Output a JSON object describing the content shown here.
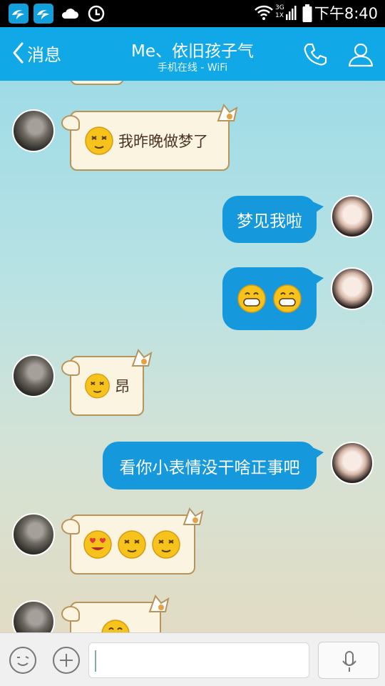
{
  "status_bar": {
    "time": "下午8:40",
    "net_3g": "3G",
    "net_1x": "1X"
  },
  "header": {
    "back_label": "消息",
    "title": "Me、依旧孩子气",
    "subtitle": "手机在线 - WiFi"
  },
  "messages": [
    {
      "side": "left",
      "text": "我昨晚做梦了",
      "emoji": [
        "sleepy-face-icon"
      ]
    },
    {
      "side": "right",
      "text": "梦见我啦",
      "emoji": []
    },
    {
      "side": "right",
      "text": "",
      "emoji": [
        "grin-face-icon",
        "grin-face-icon"
      ]
    },
    {
      "side": "left",
      "text": "昂",
      "emoji": [
        "sleepy-face-icon"
      ]
    },
    {
      "side": "right",
      "text": "看你小表情没干啥正事吧",
      "emoji": []
    },
    {
      "side": "left",
      "text": "",
      "emoji": [
        "heart-eyes-face-icon",
        "sleepy-face-icon",
        "sleepy-face-icon"
      ]
    },
    {
      "side": "left",
      "text": "",
      "emoji": [
        "grin-face-icon"
      ]
    }
  ],
  "input_bar": {
    "placeholder": ""
  },
  "colors": {
    "header_bg": "#10a8e6",
    "sent_bubble": "#1599dc",
    "received_bubble": "#fbf4e1"
  }
}
